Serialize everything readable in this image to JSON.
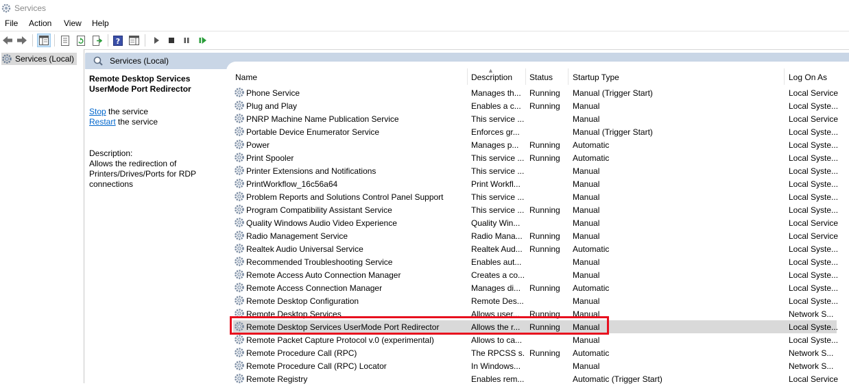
{
  "window": {
    "title": "Services"
  },
  "menu": [
    "File",
    "Action",
    "View",
    "Help"
  ],
  "toolbar": {
    "icons": [
      "back-icon",
      "forward-icon",
      "show-tree-icon",
      "properties-icon",
      "refresh-icon",
      "export-list-icon",
      "help-icon",
      "show-hide-action-pane-icon",
      "start-service-icon",
      "stop-service-icon",
      "pause-service-icon",
      "restart-service-icon"
    ]
  },
  "tree": {
    "root_label": "Services (Local)"
  },
  "pane": {
    "header": "Services (Local)",
    "selected_name": "Remote Desktop Services UserMode Port Redirector",
    "stop_link": "Stop",
    "stop_rest": " the service",
    "restart_link": "Restart",
    "restart_rest": " the service",
    "description_label": "Description:",
    "description_text": "Allows the redirection of Printers/Drives/Ports for RDP connections"
  },
  "columns": [
    "Name",
    "Description",
    "Status",
    "Startup Type",
    "Log On As"
  ],
  "services": [
    {
      "name": "Phone Service",
      "desc": "Manages th...",
      "status": "Running",
      "startup": "Manual (Trigger Start)",
      "logon": "Local Service"
    },
    {
      "name": "Plug and Play",
      "desc": "Enables a c...",
      "status": "Running",
      "startup": "Manual",
      "logon": "Local Syste..."
    },
    {
      "name": "PNRP Machine Name Publication Service",
      "desc": "This service ...",
      "status": "",
      "startup": "Manual",
      "logon": "Local Service"
    },
    {
      "name": "Portable Device Enumerator Service",
      "desc": "Enforces gr...",
      "status": "",
      "startup": "Manual (Trigger Start)",
      "logon": "Local Syste..."
    },
    {
      "name": "Power",
      "desc": "Manages p...",
      "status": "Running",
      "startup": "Automatic",
      "logon": "Local Syste..."
    },
    {
      "name": "Print Spooler",
      "desc": "This service ...",
      "status": "Running",
      "startup": "Automatic",
      "logon": "Local Syste..."
    },
    {
      "name": "Printer Extensions and Notifications",
      "desc": "This service ...",
      "status": "",
      "startup": "Manual",
      "logon": "Local Syste..."
    },
    {
      "name": "PrintWorkflow_16c56a64",
      "desc": "Print Workfl...",
      "status": "",
      "startup": "Manual",
      "logon": "Local Syste..."
    },
    {
      "name": "Problem Reports and Solutions Control Panel Support",
      "desc": "This service ...",
      "status": "",
      "startup": "Manual",
      "logon": "Local Syste..."
    },
    {
      "name": "Program Compatibility Assistant Service",
      "desc": "This service ...",
      "status": "Running",
      "startup": "Manual",
      "logon": "Local Syste..."
    },
    {
      "name": "Quality Windows Audio Video Experience",
      "desc": "Quality Win...",
      "status": "",
      "startup": "Manual",
      "logon": "Local Service"
    },
    {
      "name": "Radio Management Service",
      "desc": "Radio Mana...",
      "status": "Running",
      "startup": "Manual",
      "logon": "Local Service"
    },
    {
      "name": "Realtek Audio Universal Service",
      "desc": "Realtek Aud...",
      "status": "Running",
      "startup": "Automatic",
      "logon": "Local Syste..."
    },
    {
      "name": "Recommended Troubleshooting Service",
      "desc": "Enables aut...",
      "status": "",
      "startup": "Manual",
      "logon": "Local Syste..."
    },
    {
      "name": "Remote Access Auto Connection Manager",
      "desc": "Creates a co...",
      "status": "",
      "startup": "Manual",
      "logon": "Local Syste..."
    },
    {
      "name": "Remote Access Connection Manager",
      "desc": "Manages di...",
      "status": "Running",
      "startup": "Automatic",
      "logon": "Local Syste..."
    },
    {
      "name": "Remote Desktop Configuration",
      "desc": "Remote Des...",
      "status": "",
      "startup": "Manual",
      "logon": "Local Syste..."
    },
    {
      "name": "Remote Desktop Services",
      "desc": "Allows user...",
      "status": "Running",
      "startup": "Manual",
      "logon": "Network S..."
    },
    {
      "name": "Remote Desktop Services UserMode Port Redirector",
      "desc": "Allows the r...",
      "status": "Running",
      "startup": "Manual",
      "logon": "Local Syste...",
      "selected": true
    },
    {
      "name": "Remote Packet Capture Protocol v.0 (experimental)",
      "desc": "Allows to ca...",
      "status": "",
      "startup": "Manual",
      "logon": "Local Syste..."
    },
    {
      "name": "Remote Procedure Call (RPC)",
      "desc": "The RPCSS s...",
      "status": "Running",
      "startup": "Automatic",
      "logon": "Network S..."
    },
    {
      "name": "Remote Procedure Call (RPC) Locator",
      "desc": "In Windows...",
      "status": "",
      "startup": "Manual",
      "logon": "Network S..."
    },
    {
      "name": "Remote Registry",
      "desc": "Enables rem...",
      "status": "",
      "startup": "Automatic (Trigger Start)",
      "logon": "Local Service"
    }
  ],
  "colors": {
    "selection_outline": "#e8101e",
    "pane_header": "#c9d6e6",
    "link": "#0066cc"
  }
}
